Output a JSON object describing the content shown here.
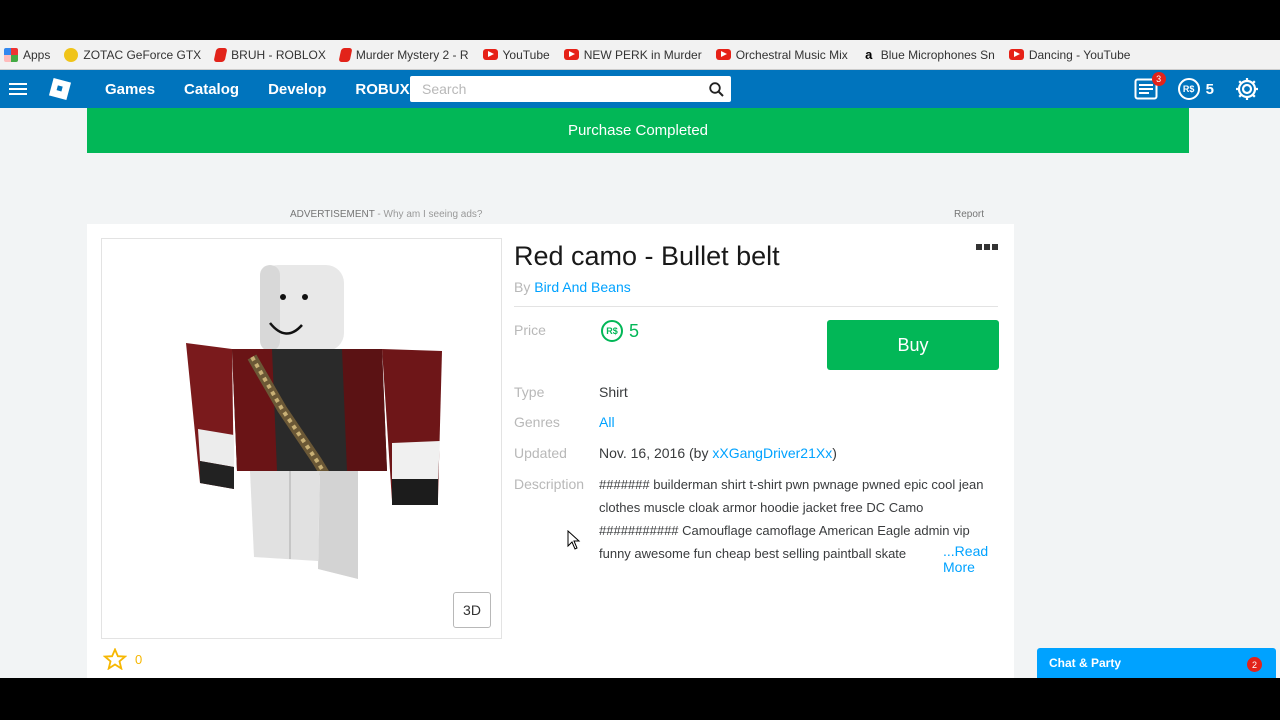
{
  "bookmarks": [
    {
      "label": "Apps",
      "icon": "apps-icon"
    },
    {
      "label": "ZOTAC GeForce GTX",
      "icon": "zotac-icon"
    },
    {
      "label": "BRUH - ROBLOX",
      "icon": "roblox-icon"
    },
    {
      "label": "Murder Mystery 2 - R",
      "icon": "roblox-icon"
    },
    {
      "label": "YouTube",
      "icon": "youtube-icon"
    },
    {
      "label": "NEW PERK in Murder",
      "icon": "youtube-icon"
    },
    {
      "label": "Orchestral Music Mix",
      "icon": "youtube-icon"
    },
    {
      "label": "Blue Microphones Sn",
      "icon": "amazon-icon"
    },
    {
      "label": "Dancing - YouTube",
      "icon": "youtube-icon"
    }
  ],
  "nav": {
    "links": [
      "Games",
      "Catalog",
      "Develop",
      "ROBUX"
    ],
    "search_placeholder": "Search",
    "messages_count": "3",
    "robux_balance": "5",
    "robux_symbol": "R$"
  },
  "banner": {
    "text": "Purchase Completed"
  },
  "ad": {
    "label": "ADVERTISEMENT",
    "why": " - Why am I seeing ads?",
    "report": "Report"
  },
  "item": {
    "title": "Red camo - Bullet belt",
    "by_label": "By ",
    "creator": "Bird And Beans",
    "price_label": "Price",
    "price_symbol": "R$",
    "price": "5",
    "buy_label": "Buy",
    "type_label": "Type",
    "type": "Shirt",
    "genres_label": "Genres",
    "genre": "All",
    "updated_label": "Updated",
    "updated_date": "Nov. 16, 2016 (by ",
    "updated_by": "xXGangDriver21Xx",
    "updated_close": ")",
    "description_label": "Description",
    "description": "####### builderman shirt t-shirt pwn pwnage pwned epic cool jean clothes muscle cloak armor hoodie jacket free DC Camo ########### Camouflage camoflage American Eagle admin vip funny awesome fun cheap best selling paintball skate",
    "read_more": "...Read More",
    "view3d_label": "3D",
    "favorites": "0"
  },
  "chat": {
    "label": "Chat & Party",
    "count": "2"
  },
  "colors": {
    "nav_blue": "#0074bd",
    "success_green": "#02b757",
    "link_blue": "#00a2ff"
  }
}
